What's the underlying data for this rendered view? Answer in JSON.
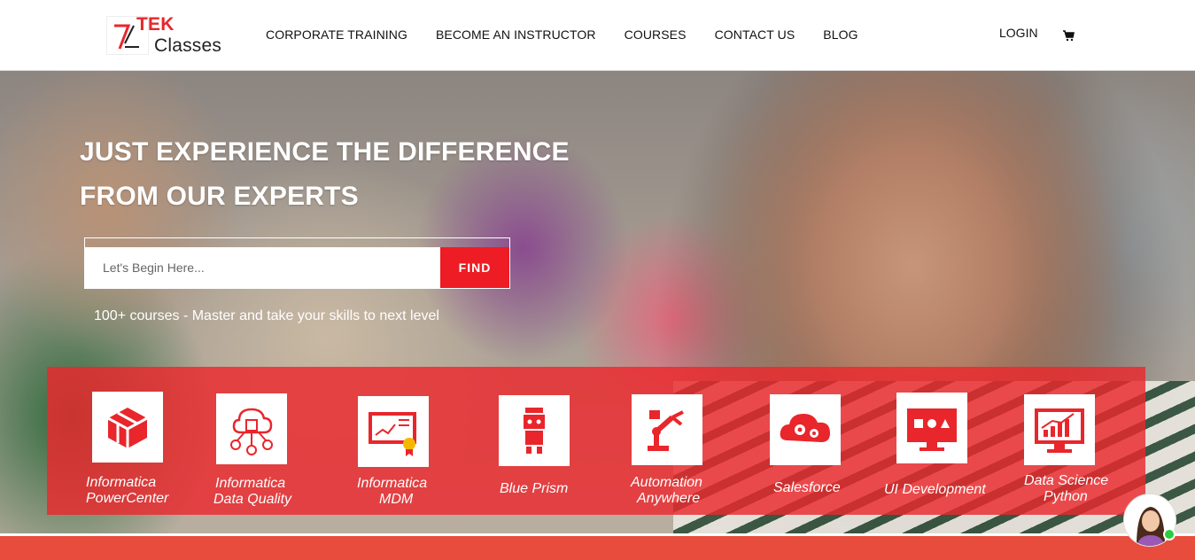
{
  "header": {
    "logo": {
      "mark": "7",
      "brand_red": "TEK",
      "brand_text": "Classes"
    },
    "nav": [
      "CORPORATE TRAINING",
      "BECOME AN INSTRUCTOR",
      "COURSES",
      "CONTACT US",
      "BLOG"
    ],
    "login_label": "LOGIN",
    "cart_icon": "cart-icon"
  },
  "hero": {
    "title_line1": "JUST EXPERIENCE THE DIFFERENCE",
    "title_line2": "FROM OUR EXPERTS",
    "search_placeholder": "Let's Begin Here...",
    "find_label": "FIND",
    "subtitle": "100+ courses - Master and take your skills to next level"
  },
  "courses": [
    {
      "line1": "Informatica",
      "line2": "PowerCenter",
      "icon": "cube-stack-icon"
    },
    {
      "line1": "Informatica",
      "line2": "Data Quality",
      "icon": "cloud-network-icon"
    },
    {
      "line1": "Informatica",
      "line2": "MDM",
      "icon": "certificate-chart-icon"
    },
    {
      "line1": "Blue Prism",
      "line2": "",
      "icon": "robot-icon"
    },
    {
      "line1": "Automation",
      "line2": "Anywhere",
      "icon": "robotic-arm-icon"
    },
    {
      "line1": "Salesforce",
      "line2": "",
      "icon": "cloud-gears-icon"
    },
    {
      "line1": "UI Development",
      "line2": "",
      "icon": "monitor-shapes-icon"
    },
    {
      "line1": "Data Science",
      "line2": "Python",
      "icon": "monitor-chart-icon"
    }
  ],
  "colors": {
    "accent": "#ee1c24",
    "band": "#eb282d",
    "bottom_bar": "#e84c3d",
    "online": "#2ecc40"
  },
  "chat": {
    "icon": "chat-avatar-icon",
    "status": "online"
  }
}
